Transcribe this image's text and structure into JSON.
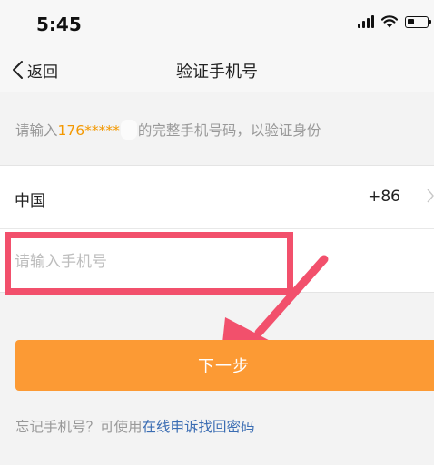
{
  "status_bar": {
    "time": "5:45",
    "icons": [
      "signal-icon",
      "wifi-icon",
      "battery-icon"
    ]
  },
  "nav": {
    "back_label": "返回",
    "title": "验证手机号"
  },
  "hint": {
    "prefix": "请输入",
    "phone_partial": "176*****",
    "suffix": "的完整手机号码，以验证身份"
  },
  "form": {
    "country_label": "中国",
    "country_code": "+86",
    "phone_value": "",
    "phone_placeholder": "请输入手机号"
  },
  "next_button_label": "下一步",
  "forgot": {
    "text": "忘记手机号？可使用",
    "link": "在线申诉找回密码"
  },
  "colors": {
    "accent_orange": "#fc9a34",
    "phone_highlight": "#f39800",
    "link_blue": "#3b6db3",
    "annotation_red": "#f2506c"
  }
}
